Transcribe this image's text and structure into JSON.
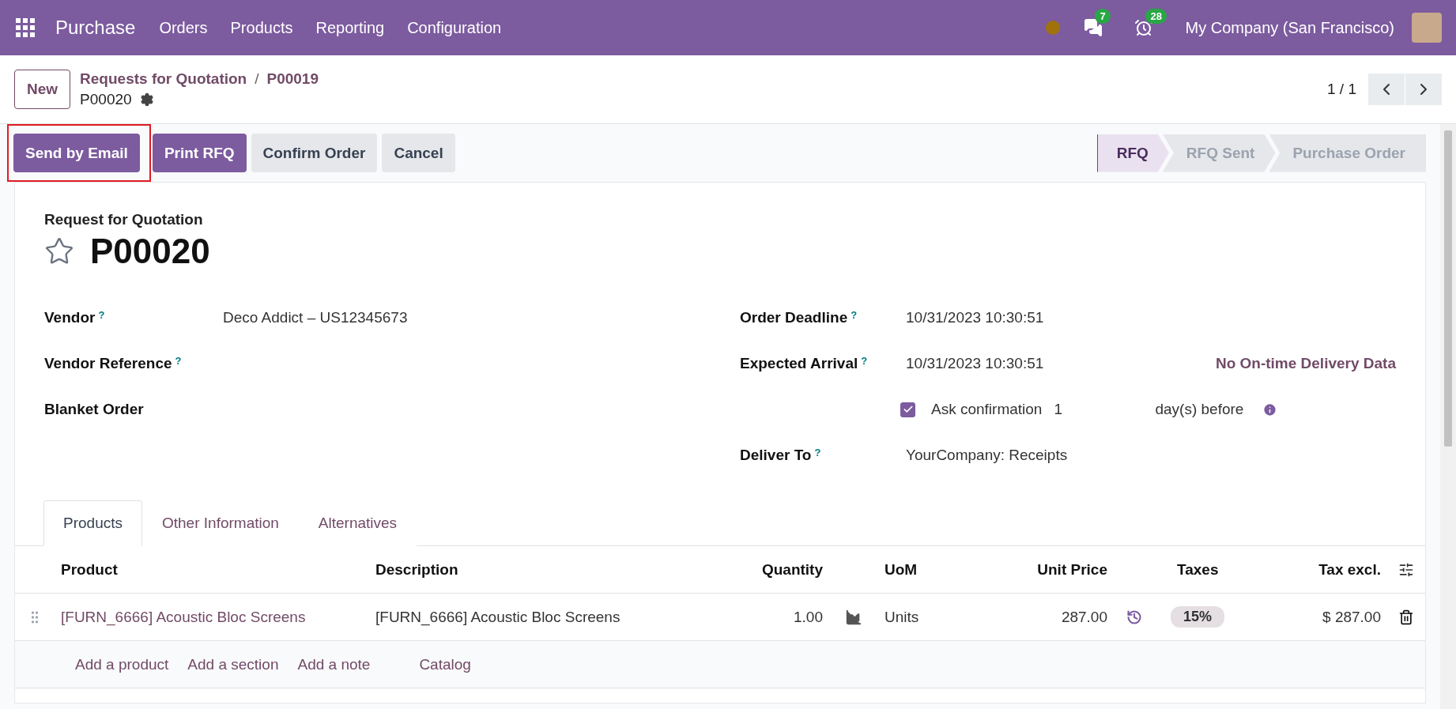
{
  "navbar": {
    "app_name": "Purchase",
    "menu": [
      "Orders",
      "Products",
      "Reporting",
      "Configuration"
    ],
    "messages_count": "7",
    "activities_count": "28",
    "company": "My Company (San Francisco)"
  },
  "control_panel": {
    "new_button": "New",
    "breadcrumbs": [
      "Requests for Quotation",
      "P00019"
    ],
    "breadcrumb_separator": "/",
    "record": "P00020",
    "pager": "1 / 1"
  },
  "actions": [
    {
      "label": "Send by Email",
      "kind": "primary",
      "highlighted": true
    },
    {
      "label": "Print RFQ",
      "kind": "primary",
      "highlighted": false
    },
    {
      "label": "Confirm Order",
      "kind": "secondary",
      "highlighted": false
    },
    {
      "label": "Cancel",
      "kind": "secondary",
      "highlighted": false
    }
  ],
  "stages": [
    {
      "label": "RFQ",
      "selected": true
    },
    {
      "label": "RFQ Sent",
      "selected": false
    },
    {
      "label": "Purchase Order",
      "selected": false
    }
  ],
  "form": {
    "subtitle": "Request for Quotation",
    "name": "P00020",
    "starred": false,
    "left_fields": [
      {
        "label": "Vendor",
        "help": "?",
        "value": "Deco Addict – US12345673"
      },
      {
        "label": "Vendor Reference",
        "help": "?"
      },
      {
        "label": "Blanket Order"
      }
    ],
    "order_deadline": {
      "label": "Order Deadline",
      "help": "?",
      "value": "10/31/2023 10:30:51"
    },
    "expected_arrival": {
      "label": "Expected Arrival",
      "help": "?",
      "value": "10/31/2023 10:30:51",
      "link": "No On-time Delivery Data"
    },
    "ask_confirmation": {
      "checked": true,
      "label": "Ask confirmation",
      "value": "1",
      "suffix": "day(s) before"
    },
    "deliver_to": {
      "label": "Deliver To",
      "help": "?",
      "value": "YourCompany: Receipts"
    }
  },
  "tabs": [
    {
      "label": "Products",
      "selected": true
    },
    {
      "label": "Other Information",
      "selected": false
    },
    {
      "label": "Alternatives",
      "selected": false
    }
  ],
  "table": {
    "columns": [
      "Product",
      "Description",
      "Quantity",
      "UoM",
      "Unit Price",
      "Taxes",
      "Tax excl."
    ],
    "rows": [
      {
        "product": "[FURN_6666] Acoustic Bloc Screens",
        "description": "[FURN_6666] Acoustic Bloc Screens",
        "quantity": "1.00",
        "uom": "Units",
        "unit_price": "287.00",
        "taxes": "15%",
        "tax_excl": "$ 287.00"
      }
    ],
    "add_links": [
      "Add a product",
      "Add a section",
      "Add a note",
      "Catalog"
    ]
  }
}
